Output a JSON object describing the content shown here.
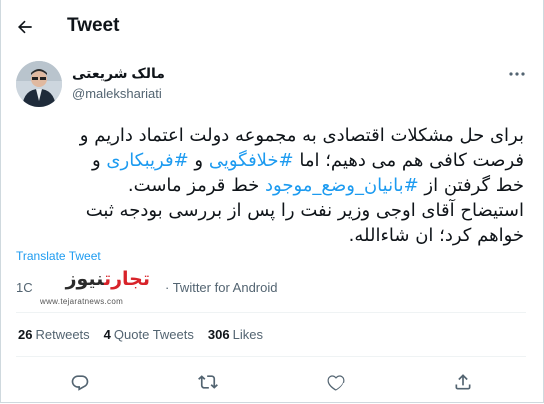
{
  "header": {
    "title": "Tweet"
  },
  "author": {
    "name": "مالک شریعتی",
    "handle": "@malekshariati"
  },
  "tweet": {
    "line1": "برای حل مشکلات اقتصادی به مجموعه دولت اعتماد داریم و",
    "line2_a": "فرصت کافی هم می دهیم؛ اما ",
    "line2_tag1": "#خلافگویی",
    "line2_b": " و ",
    "line2_tag2": "#فریبکاری",
    "line2_c": " و",
    "line3_a": "خط گرفتن از ",
    "line3_tag": "#بانیان_وضع_موجود",
    "line3_b": " خط قرمز ماست.",
    "line4": "استیضاح آقای اوجی وزیر نفت را پس از بررسی بودجه ثبت",
    "line5": "خواهم کرد؛ ان شاءالله."
  },
  "translate_label": "Translate Tweet",
  "meta": {
    "time_partial": "1C",
    "source": "· Twitter for Android"
  },
  "watermark": {
    "part_red": "تجارت",
    "part_dark": "نیوز",
    "url": "www.tejaratnews.com"
  },
  "stats": [
    {
      "count": "26",
      "label": "Retweets"
    },
    {
      "count": "4",
      "label": "Quote Tweets"
    },
    {
      "count": "306",
      "label": "Likes"
    }
  ],
  "colors": {
    "accent": "#1d9bf0",
    "text": "#0f1419",
    "secondary": "#536471",
    "brand_red": "#d8232a"
  },
  "icons": [
    "back-arrow-icon",
    "more-icon",
    "reply-icon",
    "retweet-icon",
    "like-icon",
    "share-icon"
  ]
}
